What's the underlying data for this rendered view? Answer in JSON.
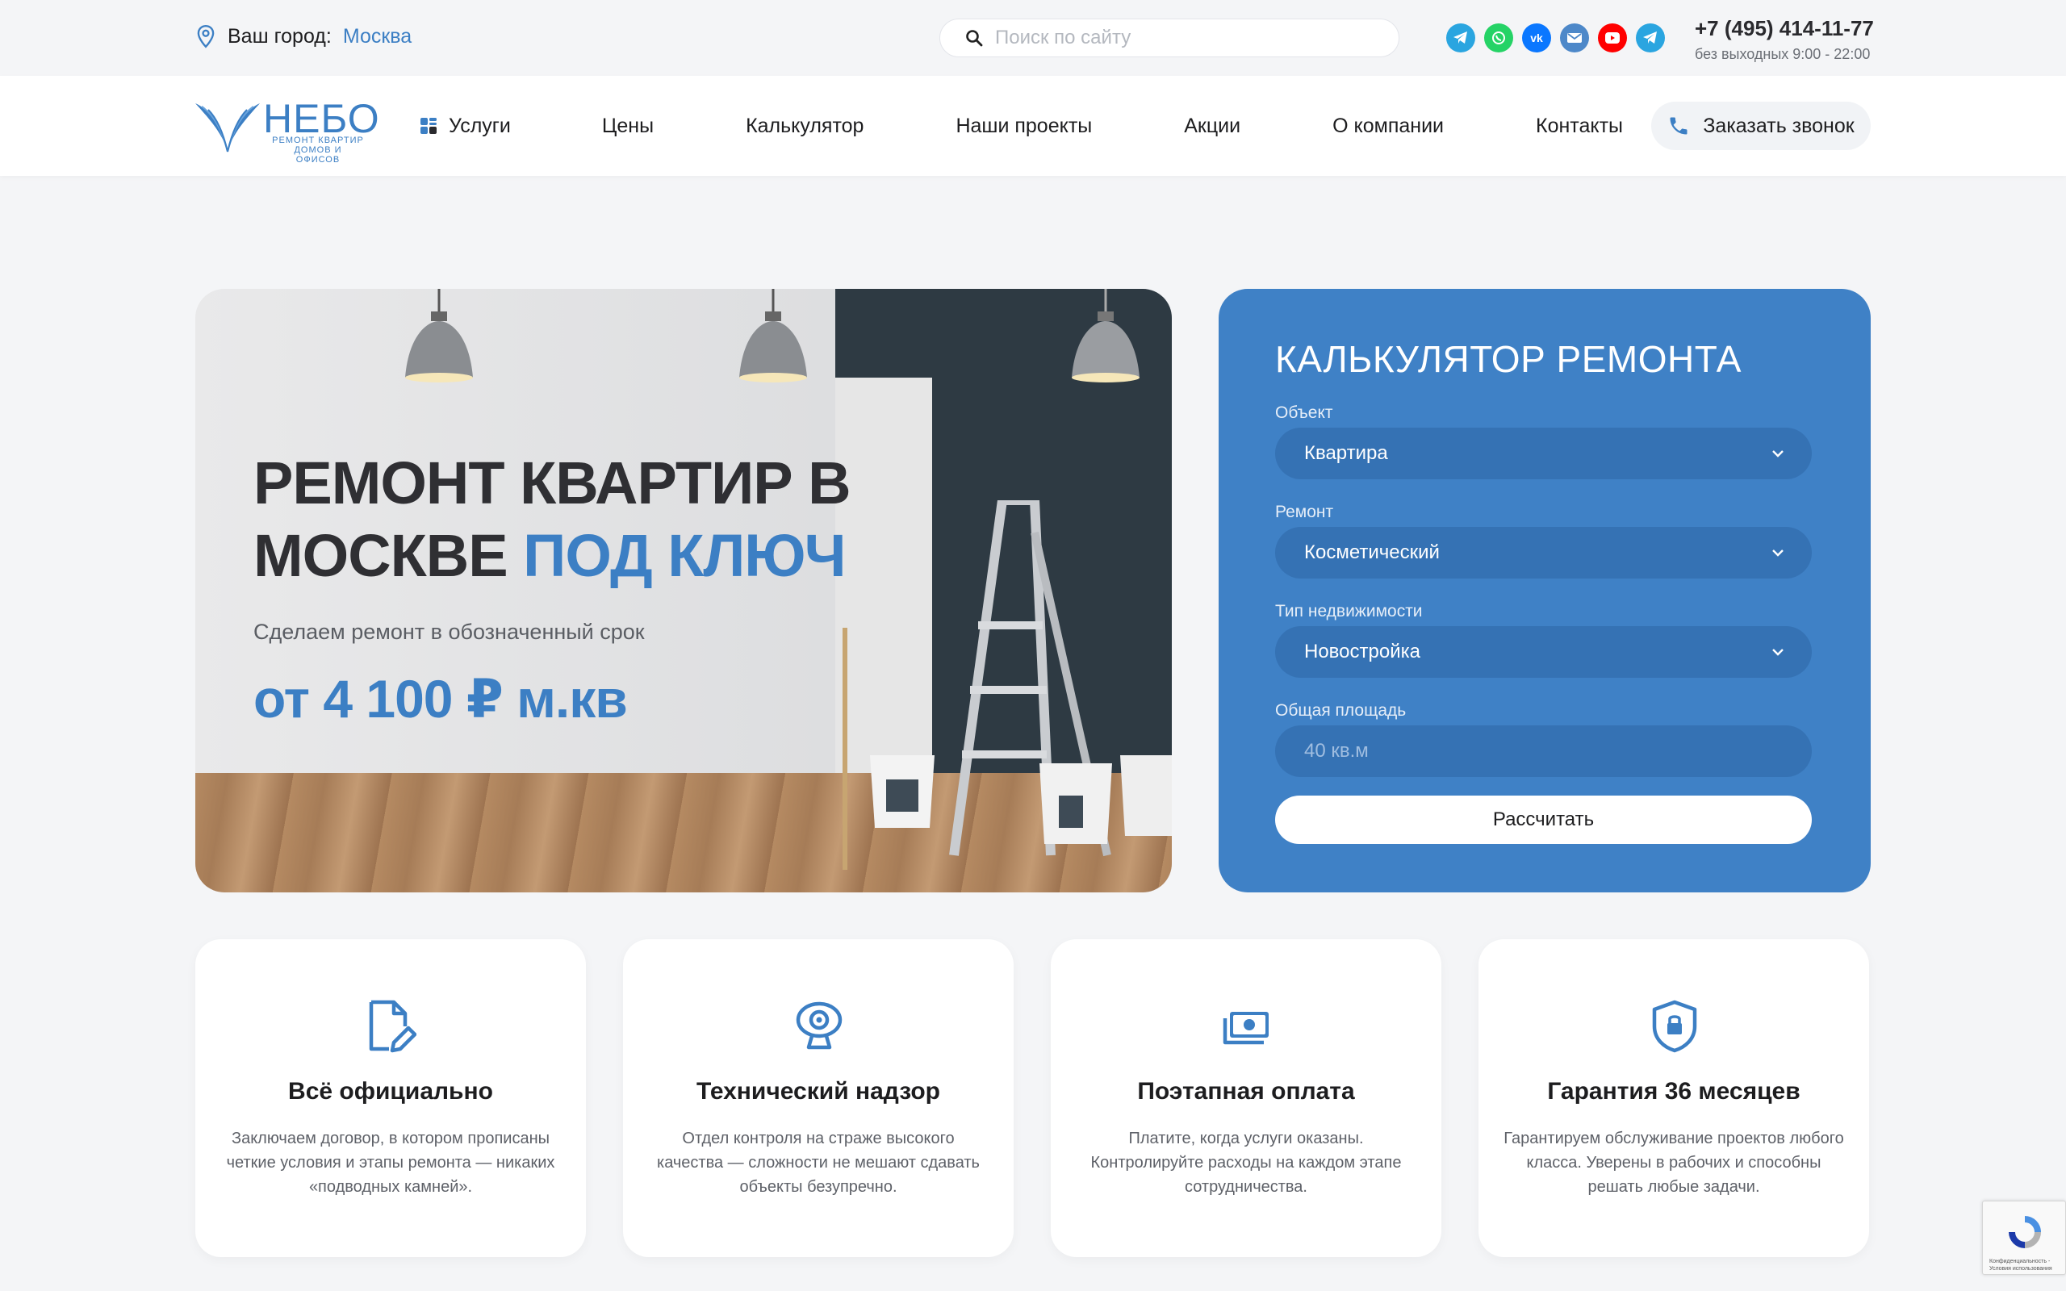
{
  "topbar": {
    "city_label": "Ваш город:",
    "city_value": "Москва",
    "search_placeholder": "Поиск по сайту",
    "socials": [
      {
        "name": "telegram-icon",
        "color": "#2aa5e0"
      },
      {
        "name": "whatsapp-icon",
        "color": "#25d366"
      },
      {
        "name": "vk-icon",
        "color": "#0a77ff"
      },
      {
        "name": "mail-icon",
        "color": "#4d88c9"
      },
      {
        "name": "youtube-icon",
        "color": "#ff0000"
      },
      {
        "name": "telegram-icon",
        "color": "#2aa5e0"
      }
    ],
    "phone": "+7 (495) 414-11-77",
    "hours": "без выходных 9:00 - 22:00"
  },
  "logo": {
    "name": "НЕБО",
    "subtitle_line1": "РЕМОНТ КВАРТИР",
    "subtitle_line2": "ДОМОВ И ОФИСОВ"
  },
  "nav": {
    "services": "Услуги",
    "prices": "Цены",
    "calculator": "Калькулятор",
    "projects": "Наши проекты",
    "promo": "Акции",
    "about": "О компании",
    "contacts": "Контакты",
    "callback": "Заказать звонок"
  },
  "hero": {
    "title_line1": "РЕМОНТ КВАРТИР В",
    "title_line2_plain": "МОСКВЕ ",
    "title_line2_accent": "ПОД КЛЮЧ",
    "subtitle": "Сделаем ремонт в обозначенный срок",
    "price": "от 4 100 ₽ м.кв"
  },
  "calculator": {
    "title": "КАЛЬКУЛЯТОР РЕМОНТА",
    "object_label": "Объект",
    "object_value": "Квартира",
    "repair_label": "Ремонт",
    "repair_value": "Косметический",
    "property_label": "Тип недвижимости",
    "property_value": "Новостройка",
    "area_label": "Общая площадь",
    "area_placeholder": "40 кв.м",
    "button": "Рассчитать"
  },
  "features": [
    {
      "title": "Всё официально",
      "text": "Заключаем договор, в котором прописаны четкие условия и этапы ремонта — никаких «подводных камней»."
    },
    {
      "title": "Технический надзор",
      "text": "Отдел контроля на страже высокого качества — сложности не мешают сдавать объекты безупречно."
    },
    {
      "title": "Поэтапная оплата",
      "text": "Платите, когда услуги оказаны. Контролируйте расходы на каждом этапе сотрудничества."
    },
    {
      "title": "Гарантия 36 месяцев",
      "text": "Гарантируем обслуживание проектов любого класса. Уверены в рабочих и способны решать любые задачи."
    }
  ],
  "recaptcha": {
    "text_line1": "Конфиденциальность -",
    "text_line2": "Условия использования"
  },
  "colors": {
    "accent": "#3c7fc4",
    "calculator_bg": "#3f81c6"
  }
}
